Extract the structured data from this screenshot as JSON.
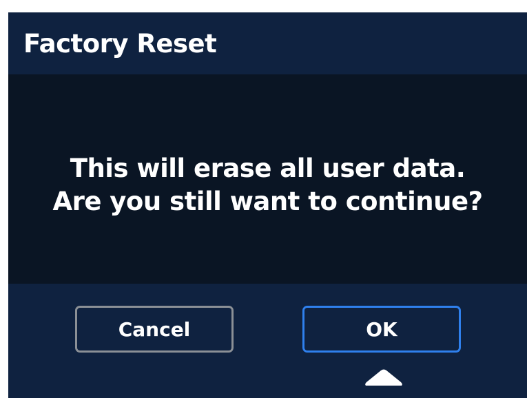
{
  "dialog": {
    "title": "Factory Reset",
    "message_lines": [
      "This will erase all user data.",
      "Are you still want to continue?"
    ]
  },
  "buttons": {
    "cancel_label": "Cancel",
    "ok_label": "OK",
    "selected": "OK"
  },
  "colors": {
    "header_background": "#0f2240",
    "message_background": "#0a1524",
    "ok_border": "#2f80ed",
    "cancel_border": "#8b9096",
    "text": "#ffffff"
  },
  "icons": {
    "selection_indicator": "triangle-up-icon"
  }
}
